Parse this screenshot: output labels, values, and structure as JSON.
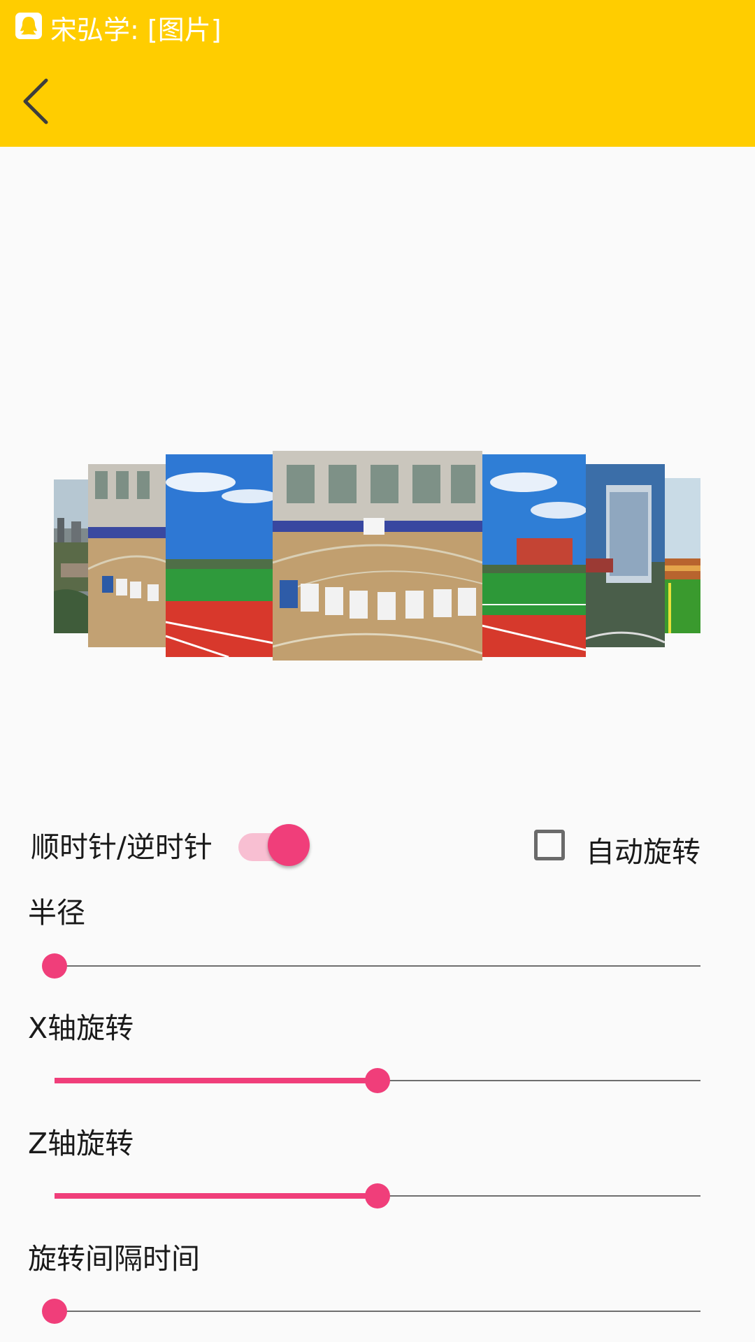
{
  "status_bar": {
    "icon": "qq-penguin-icon",
    "text": "宋弘学: [图片]"
  },
  "app_bar": {
    "back_icon": "chevron-left-icon",
    "background_color": "#ffcd00"
  },
  "gallery": {
    "images": [
      "campus-aerial-photo",
      "gym-students-circle-photo",
      "running-track-sky-photo",
      "gym-students-circle-photo",
      "track-red-building-photo",
      "tall-building-photo",
      "stadium-crowd-photo"
    ]
  },
  "controls": {
    "direction_label": "顺时针/逆时针",
    "direction_toggle_on": true,
    "auto_rotate_label": "自动旋转",
    "auto_rotate_checked": false,
    "sliders": [
      {
        "label": "半径",
        "value_fraction": 0.0
      },
      {
        "label": "X轴旋转",
        "value_fraction": 0.5
      },
      {
        "label": "Z轴旋转",
        "value_fraction": 0.5
      },
      {
        "label": "旋转间隔时间",
        "value_fraction": 0.0
      }
    ],
    "accent_color": "#f03e7a"
  }
}
